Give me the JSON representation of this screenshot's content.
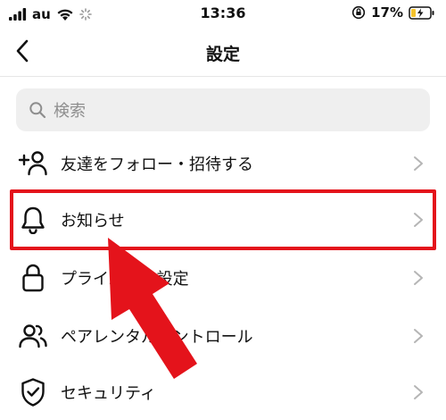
{
  "status_bar": {
    "carrier": "au",
    "time": "13:36",
    "battery_percent": "17%"
  },
  "header": {
    "title": "設定",
    "back_icon": "chevron-left-icon"
  },
  "search": {
    "placeholder": "検索",
    "icon": "search-icon"
  },
  "menu": {
    "items": [
      {
        "label": "友達をフォロー・招待する",
        "icon": "add-person-icon"
      },
      {
        "label": "お知らせ",
        "icon": "bell-icon"
      },
      {
        "label": "プライバシー設定",
        "icon": "lock-icon"
      },
      {
        "label": "ペアレンタルコントロール",
        "icon": "people-icon"
      },
      {
        "label": "セキュリティ",
        "icon": "shield-check-icon"
      }
    ]
  },
  "annotation": {
    "highlight_color": "#e4131b",
    "arrow_color": "#e4131b"
  }
}
